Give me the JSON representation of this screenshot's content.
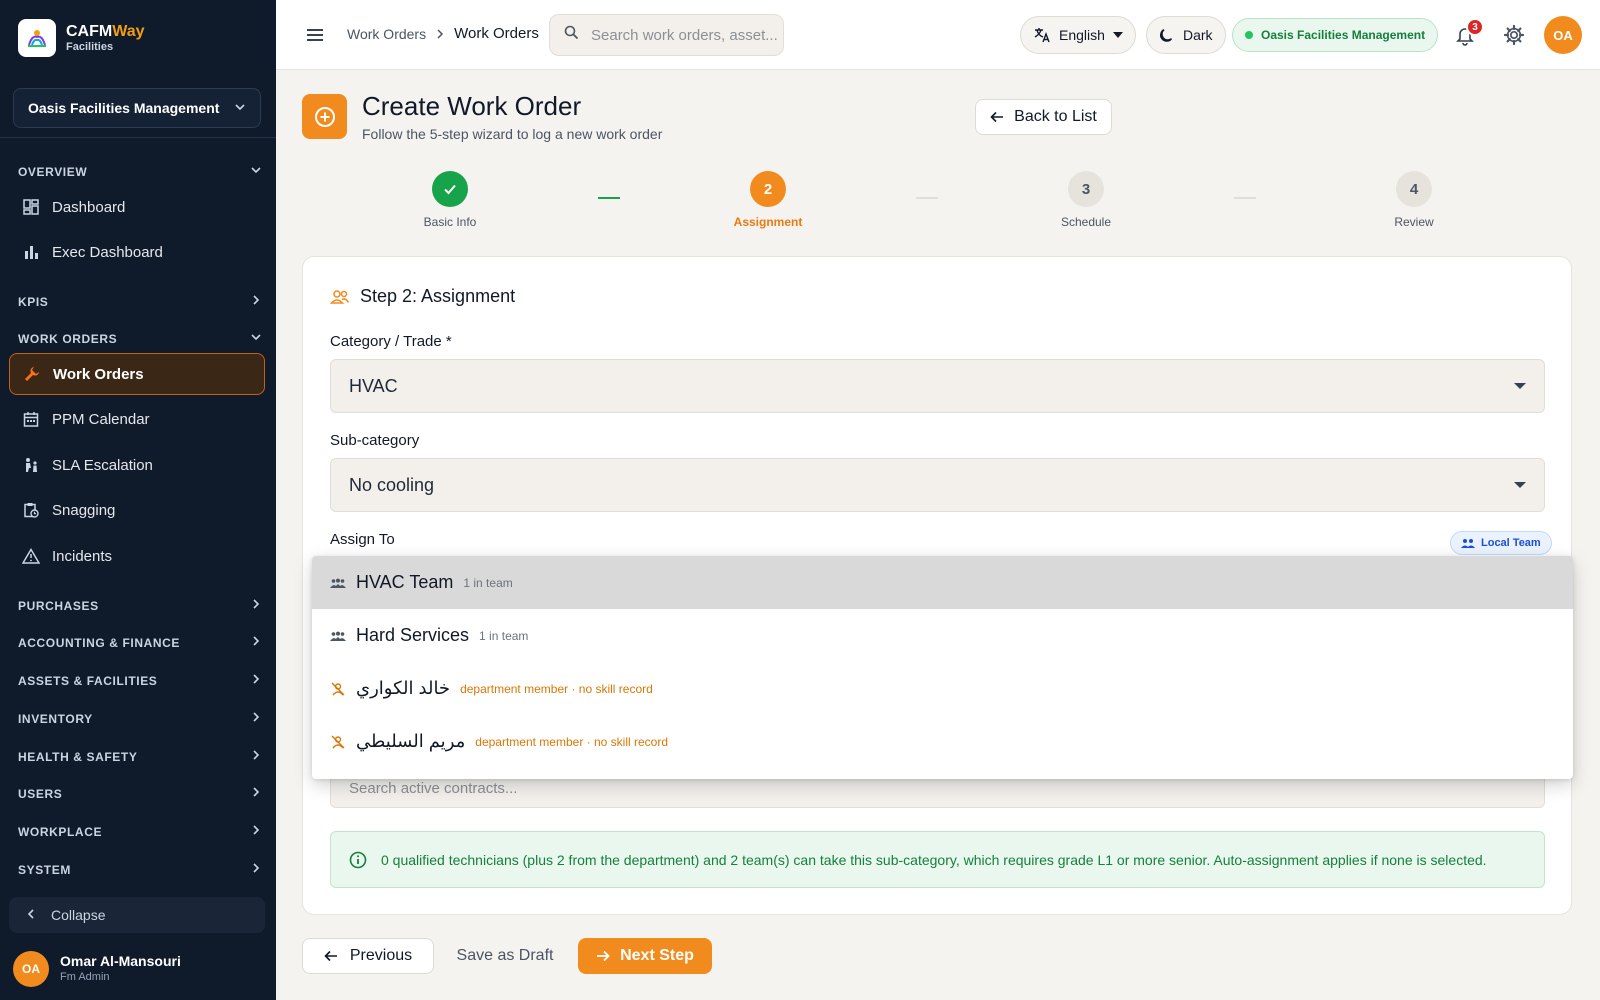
{
  "brand": {
    "name_main": "CAFM",
    "name_accent": "Way",
    "sub": "Facilities"
  },
  "sidebar": {
    "org": "Oasis Facilities Management",
    "sections": {
      "overview": "OVERVIEW",
      "kpis": "KPIS",
      "work_orders": "WORK ORDERS",
      "purchases": "PURCHASES",
      "accounting": "ACCOUNTING & FINANCE",
      "assets": "ASSETS & FACILITIES",
      "inventory": "INVENTORY",
      "health": "HEALTH & SAFETY",
      "users": "USERS",
      "workplace": "WORKPLACE",
      "system": "SYSTEM"
    },
    "items": {
      "dashboard": "Dashboard",
      "exec_dashboard": "Exec Dashboard",
      "work_orders": "Work Orders",
      "ppm_calendar": "PPM Calendar",
      "sla_escalation": "SLA Escalation",
      "snagging": "Snagging",
      "incidents": "Incidents"
    },
    "collapse": "Collapse",
    "user": {
      "initials": "OA",
      "name": "Omar Al-Mansouri",
      "role": "Fm Admin"
    }
  },
  "topbar": {
    "breadcrumb": [
      "Work Orders",
      "Work Orders"
    ],
    "search_placeholder": "Search work orders, asset...",
    "language": "English",
    "theme": "Dark",
    "org": "Oasis Facilities Management",
    "notifications": "3",
    "avatar": "OA"
  },
  "header": {
    "title": "Create Work Order",
    "subtitle": "Follow the 5-step wizard to log a new work order",
    "back": "Back to List"
  },
  "steps": [
    {
      "label": "Basic Info",
      "status": "done"
    },
    {
      "num": "2",
      "label": "Assignment",
      "status": "current"
    },
    {
      "num": "3",
      "label": "Schedule",
      "status": "todo"
    },
    {
      "num": "4",
      "label": "Review",
      "status": "todo"
    }
  ],
  "form": {
    "title": "Step 2: Assignment",
    "category_label": "Category / Trade *",
    "category_value": "HVAC",
    "subcategory_label": "Sub-category",
    "subcategory_value": "No cooling",
    "assign_label": "Assign To",
    "local_team": "Local Team",
    "contract_placeholder": "Search active contracts...",
    "info": "0 qualified technicians (plus 2 from the department) and 2 team(s) can take this sub-category, which requires grade L1 or more senior. Auto-assignment applies if none is selected."
  },
  "dropdown": [
    {
      "name": "HVAC Team",
      "meta": "1 in team",
      "kind": "team"
    },
    {
      "name": "Hard Services",
      "meta": "1 in team",
      "kind": "team"
    },
    {
      "name": "خالد الكواري",
      "meta": "department member · no skill record",
      "kind": "member"
    },
    {
      "name": "مريم السليطي",
      "meta": "department member · no skill record",
      "kind": "member"
    }
  ],
  "footer": {
    "previous": "Previous",
    "draft": "Save as Draft",
    "next": "Next Step"
  },
  "colors": {
    "accent": "#f28b1d",
    "success": "#16a34a",
    "sidebar": "#0f1a2a"
  }
}
